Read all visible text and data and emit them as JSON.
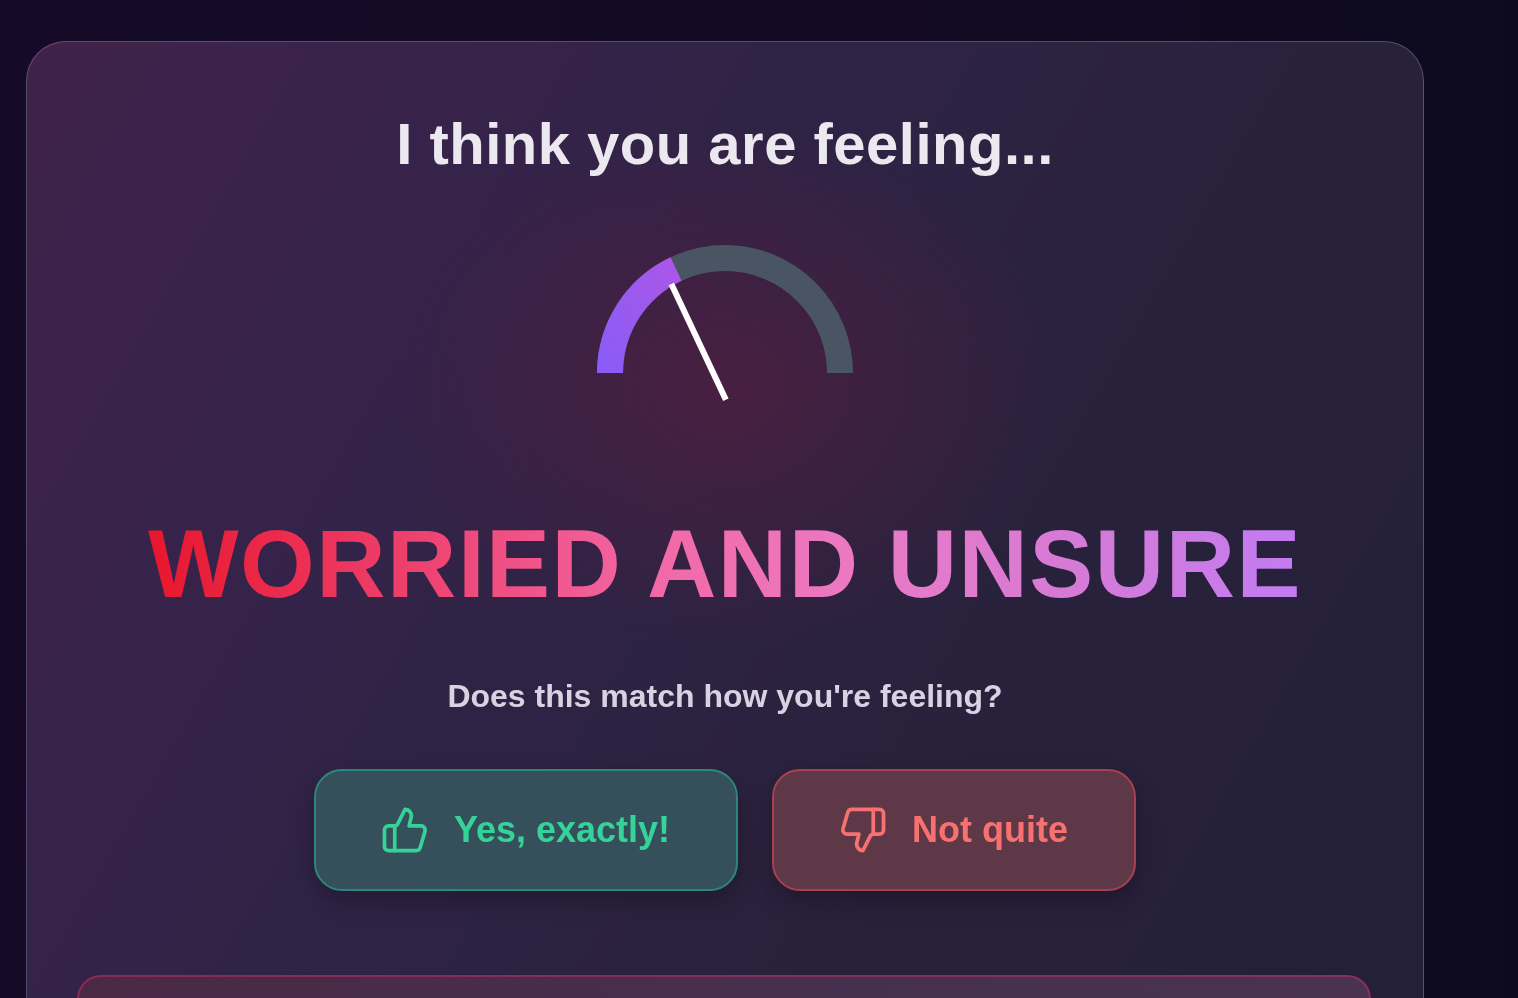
{
  "prompt": {
    "title": "I think you are feeling..."
  },
  "gauge": {
    "level": 0.36
  },
  "emotion": {
    "label": "WORRIED AND UNSURE"
  },
  "question": "Does this match how you're feeling?",
  "buttons": [
    {
      "label": "Yes, exactly!",
      "kind": "confirm"
    },
    {
      "label": "Not quite",
      "kind": "reject"
    }
  ]
}
